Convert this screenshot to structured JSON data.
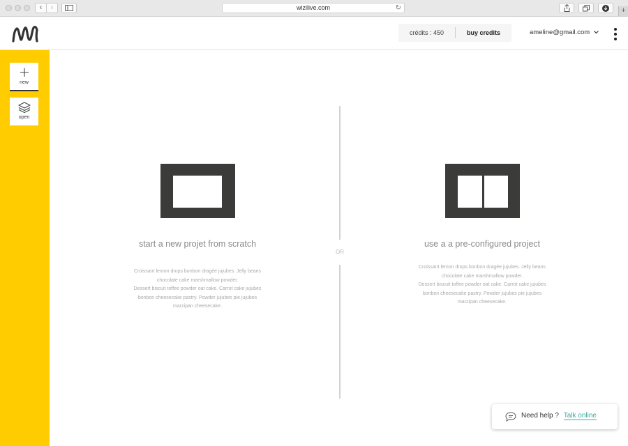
{
  "browser": {
    "url": "wizilive.com",
    "back_icon": "chevron-left-icon",
    "forward_icon": "chevron-right-icon",
    "sidebar_icon": "sidebar-icon",
    "reload_icon": "reload-icon",
    "share_icon": "share-icon",
    "tabs_icon": "tabs-icon",
    "download_icon": "download-icon",
    "new_tab_label": "+"
  },
  "header": {
    "logo_icon": "wizilive-logo",
    "credits_label": "crédits : 450",
    "buy_credits_label": "buy credits",
    "user_email": "ameline@gmail.com",
    "user_menu_icon": "chevron-down-icon",
    "more_icon": "kebab-menu-icon"
  },
  "sidebar": {
    "items": [
      {
        "label": "new",
        "icon": "plus-icon",
        "active": true
      },
      {
        "label": "open",
        "icon": "layers-icon",
        "active": false
      }
    ]
  },
  "main": {
    "separator_label": "OR",
    "options": [
      {
        "title": "start a new projet from scratch",
        "description_lines": [
          "Croissant lemon drops bonbon dragée jujubes. Jelly beans",
          "chocolate cake marshmallow powder.",
          "Dessert biscuit toffee powder oat cake. Carrot cake jujubes",
          "bonbon cheesecake pastry. Powder jujubes pie jujubes",
          "marzipan cheesecake."
        ]
      },
      {
        "title": "use a a pre-configured project",
        "description_lines": [
          "Croissant lemon drops bonbon dragée jujubes. Jelly beans",
          "chocolate cake marshmallow powder.",
          "Dessert biscuit toffee powder oat cake. Carrot cake jujubes",
          "bonbon cheesecake pastry. Powder jujubes pie jujubes",
          "marzipan cheesecake."
        ]
      }
    ]
  },
  "help": {
    "icon": "chat-bubble-icon",
    "prompt": "Need help ?",
    "link_label": "Talk online",
    "link_color": "#3aa9a0"
  },
  "colors": {
    "sidebar_accent": "#ffcc00",
    "preview_frame": "#3b3b39"
  }
}
